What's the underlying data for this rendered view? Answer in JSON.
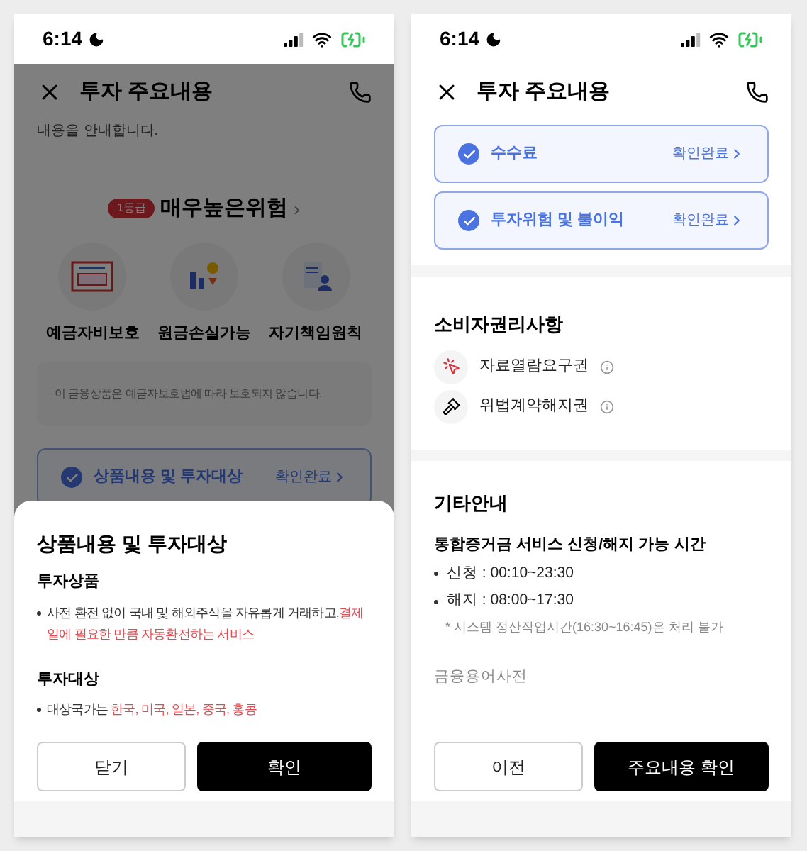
{
  "screens": [
    {
      "status_bar": {
        "time": "6:14"
      },
      "header": {
        "title": "투자 주요내용"
      },
      "dimmed": true,
      "intro": "내용을 안내합니다.",
      "risk": {
        "badge": "1등급",
        "label": "매우높은위험",
        "arrow": "›"
      },
      "features": [
        {
          "kind": "deposit",
          "label": "예금자비보호"
        },
        {
          "kind": "loss",
          "label": "원금손실가능"
        },
        {
          "kind": "responsibility",
          "label": "자기책임원칙"
        }
      ],
      "notice": "· 이 금융상품은 예금자보호법에 따라 보호되지 않습니다.",
      "check_items": [
        {
          "label": "상품내용 및 투자대상",
          "status": "확인완료",
          "checked": true
        }
      ],
      "sheet": {
        "title": "상품내용 및 투자대상",
        "sections": [
          {
            "heading": "투자상품",
            "bullets": [
              [
                {
                  "text": "사전 환전 없이 국내 및 해외주식을 자유롭게 거래하고,",
                  "highlight": false
                },
                {
                  "text": "결제일에 필요한 만큼 자동환전하는 서비스",
                  "highlight": true
                }
              ]
            ]
          },
          {
            "heading": "투자대상",
            "bullets": [
              [
                {
                  "text": "대상국가는 ",
                  "highlight": false
                },
                {
                  "text": "한국, 미국, 일본, 중국, 홍콩",
                  "highlight": true
                }
              ]
            ]
          }
        ]
      },
      "buttons": [
        {
          "label": "닫기",
          "kind": "secondary"
        },
        {
          "label": "확인",
          "kind": "primary"
        }
      ]
    },
    {
      "status_bar": {
        "time": "6:14"
      },
      "header": {
        "title": "투자 주요내용"
      },
      "dimmed": false,
      "check_items": [
        {
          "label": "수수료",
          "status": "확인완료",
          "checked": true
        },
        {
          "label": "투자위험 및 불이익",
          "status": "확인완료",
          "checked": true
        }
      ],
      "rights": {
        "title": "소비자권리사항",
        "items": [
          {
            "kind": "click",
            "label": "자료열람요구권"
          },
          {
            "kind": "gavel",
            "label": "위법계약해지권"
          }
        ]
      },
      "other": {
        "title": "기타안내",
        "subtitle": "통합증거금 서비스 신청/해지 가능 시간",
        "bullets": [
          "신청 : 00:10~23:30",
          "해지 : 08:00~17:30"
        ],
        "note": "* 시스템 정산작업시간(16:30~16:45)은 처리 불가",
        "link": "금융용어사전"
      },
      "buttons": [
        {
          "label": "이전",
          "kind": "secondary"
        },
        {
          "label": "주요내용 확인",
          "kind": "primary"
        }
      ]
    }
  ]
}
